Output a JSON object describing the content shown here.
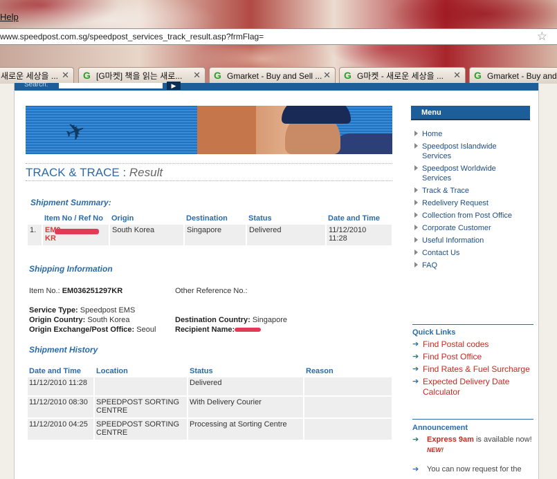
{
  "browser": {
    "menu_help": "Help",
    "url": "www.speedpost.com.sg/speedpost_services_track_result.asp?frmFlag=",
    "tabs": [
      {
        "label": "새로운 세상을 ..."
      },
      {
        "label": "[G마켓] 책을 읽는 새로..."
      },
      {
        "label": "Gmarket - Buy and Sell ..."
      },
      {
        "label": "G마켓 - 새로운 세상을 ..."
      },
      {
        "label": "Gmarket - Buy and ..."
      }
    ]
  },
  "search": {
    "label": "Search:"
  },
  "title": {
    "main": "TRACK & TRACE",
    "sep": " : ",
    "sub": "Result"
  },
  "summary": {
    "heading": "Shipment Summary:",
    "headers": [
      "Item No / Ref No",
      "Origin",
      "Destination",
      "Status",
      "Date and Time"
    ],
    "row": {
      "index": "1.",
      "item_prefix": "EM0",
      "item_suffix": "KR",
      "origin": "South Korea",
      "destination": "Singapore",
      "status": "Delivered",
      "date": "11/12/2010",
      "time": "11:28"
    }
  },
  "shipping": {
    "heading": "Shipping Information",
    "item_no_label": "Item No.:",
    "item_no": "EM036251297KR",
    "other_ref_label": "Other Reference No.:",
    "service_type_label": "Service Type:",
    "service_type": "Speedpost EMS",
    "origin_country_label": "Origin Country:",
    "origin_country": "South Korea",
    "origin_exchange_label": "Origin Exchange/Post Office:",
    "origin_exchange": "Seoul",
    "dest_country_label": "Destination Country:",
    "dest_country": "Singapore",
    "recipient_label": "Recipient Name:"
  },
  "history": {
    "heading": "Shipment History",
    "headers": [
      "Date and Time",
      "Location",
      "Status",
      "Reason"
    ],
    "rows": [
      {
        "datetime": "11/12/2010 11:28",
        "location": "",
        "status": "Delivered",
        "reason": ""
      },
      {
        "datetime": "11/12/2010 08:30",
        "location": "SPEEDPOST SORTING CENTRE",
        "status": "With Delivery Courier",
        "reason": ""
      },
      {
        "datetime": "11/12/2010 04:25",
        "location": "SPEEDPOST SORTING CENTRE",
        "status": "Processing at Sorting Centre",
        "reason": ""
      }
    ]
  },
  "sidebar": {
    "menu_title": "Menu",
    "items": [
      {
        "label": "Home"
      },
      {
        "label": "Speedpost Islandwide Services"
      },
      {
        "label": "Speedpost Worldwide Services"
      },
      {
        "label": "Track & Trace"
      },
      {
        "label": "Redelivery Request"
      },
      {
        "label": "Collection from Post Office"
      },
      {
        "label": "Corporate Customer"
      },
      {
        "label": "Useful Information"
      },
      {
        "label": "Contact Us"
      },
      {
        "label": "FAQ"
      }
    ],
    "quick_links_title": "Quick Links",
    "quick_links": [
      {
        "label": "Find Postal codes"
      },
      {
        "label": "Find Post Office"
      },
      {
        "label": "Find Rates & Fuel Surcharge"
      },
      {
        "label": "Expected Delivery Date Calculator"
      }
    ],
    "announcement_title": "Announcement",
    "announcements": [
      {
        "highlight": "Express 9am",
        "text": " is available now!",
        "badge": "NEW!"
      },
      {
        "text": "You can now request for the"
      }
    ]
  },
  "colors": {
    "brand_blue": "#1d5d98",
    "link_red": "#c42b22",
    "heading_blue": "#2a6ba8"
  },
  "icons": {
    "bookmark": "star-icon",
    "tab_favicon": "gmarket-g-icon",
    "tab_close": "close-icon",
    "menu_bullet": "triangle-right-icon",
    "link_bullet": "arrow-right-icon"
  }
}
